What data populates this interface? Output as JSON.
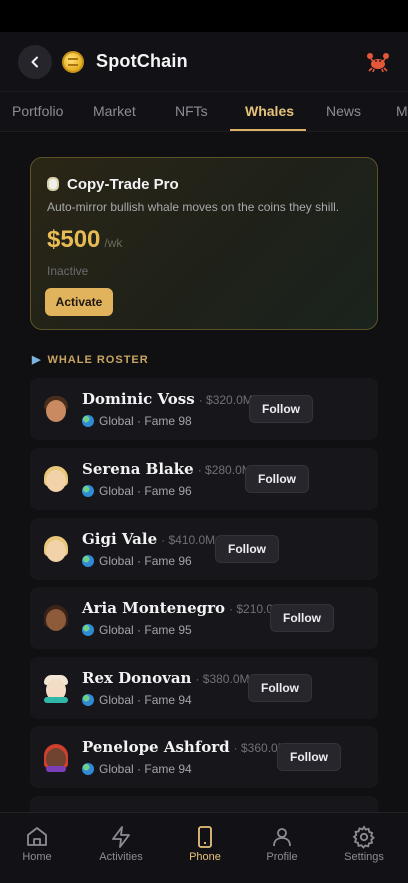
{
  "header": {
    "title": "SpotChain",
    "back_icon": "chevron-left-icon",
    "logo_icon": "gold-coin-icon",
    "profile_icon": "crab-icon"
  },
  "tabs": [
    {
      "label": "Portfolio"
    },
    {
      "label": "Market"
    },
    {
      "label": "NFTs"
    },
    {
      "label": "Whales",
      "active": true
    },
    {
      "label": "News"
    },
    {
      "label": "M"
    }
  ],
  "promo": {
    "title": "Copy-Trade Pro",
    "description": "Auto-mirror bullish whale moves on the coins they shill.",
    "price": "$500",
    "price_unit": "/wk",
    "status": "Inactive",
    "action_label": "Activate",
    "accent_color": "#e0b35c"
  },
  "roster": {
    "label": "WHALE ROSTER",
    "whales": [
      {
        "name": "Dominic Voss",
        "worth": "· $320.0M",
        "region": "Global",
        "fame": "· Fame 98",
        "follow_label": "Follow"
      },
      {
        "name": "Serena Blake",
        "worth": "· $280.0M",
        "region": "Global",
        "fame": "· Fame 96",
        "follow_label": "Follow"
      },
      {
        "name": "Gigi Vale",
        "worth": "· $410.0M",
        "region": "Global",
        "fame": "· Fame 96",
        "follow_label": "Follow"
      },
      {
        "name": "Aria Montenegro",
        "worth": "· $210.0M",
        "region": "Global",
        "fame": "· Fame 95",
        "follow_label": "Follow"
      },
      {
        "name": "Rex Donovan",
        "worth": "· $380.0M",
        "region": "Global",
        "fame": "· Fame 94",
        "follow_label": "Follow"
      },
      {
        "name": "Penelope Ashford",
        "worth": "· $360.0M",
        "region": "Global",
        "fame": "· Fame 94",
        "follow_label": "Follow"
      }
    ]
  },
  "bottom_nav": [
    {
      "label": "Home",
      "icon": "home-icon"
    },
    {
      "label": "Activities",
      "icon": "lightning-icon"
    },
    {
      "label": "Phone",
      "icon": "phone-icon",
      "active": true
    },
    {
      "label": "Profile",
      "icon": "user-icon"
    },
    {
      "label": "Settings",
      "icon": "gear-icon"
    }
  ]
}
